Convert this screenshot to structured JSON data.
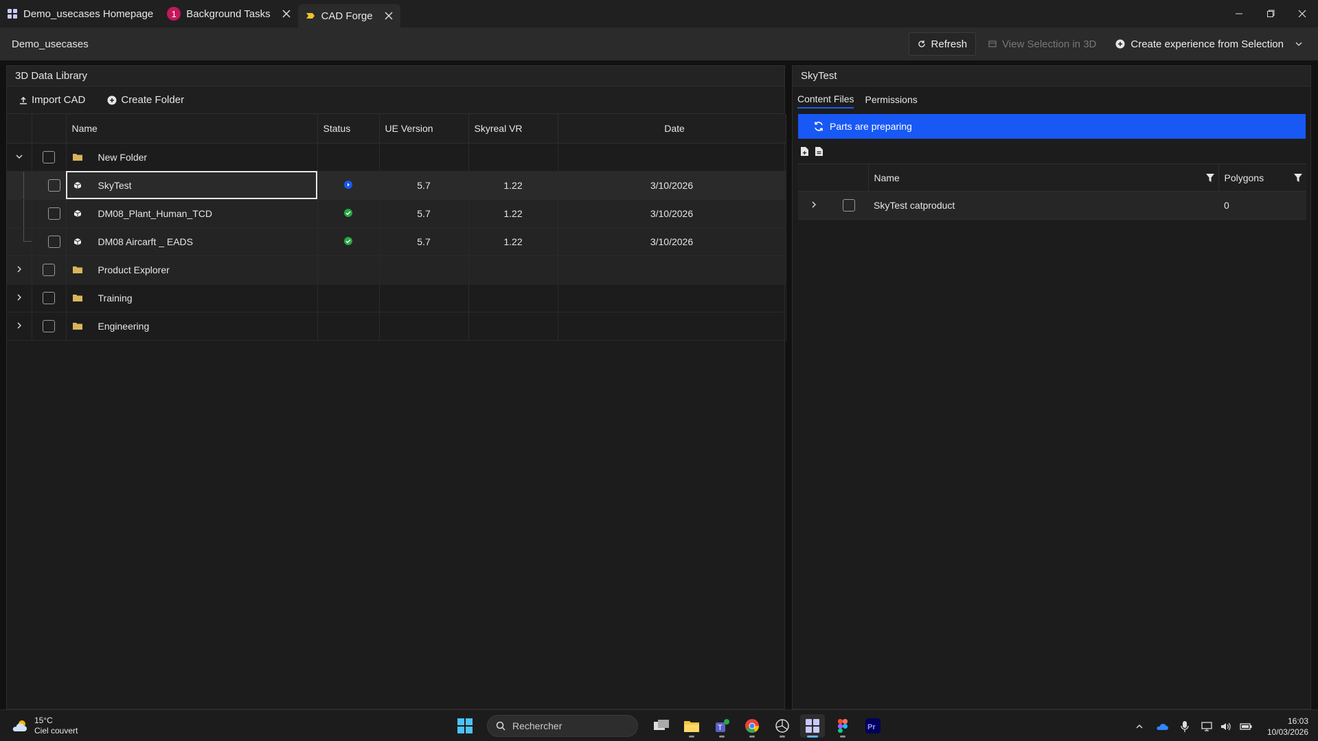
{
  "window": {
    "tabs": [
      {
        "label": "Demo_usecases Homepage"
      },
      {
        "label": "Background Tasks",
        "badge": "1"
      },
      {
        "label": "CAD Forge"
      }
    ]
  },
  "header": {
    "breadcrumb": "Demo_usecases",
    "refresh_label": "Refresh",
    "view_selection_label": "View Selection in 3D",
    "create_experience_label": "Create experience from Selection"
  },
  "library": {
    "title": "3D Data Library",
    "import_label": "Import CAD",
    "create_folder_label": "Create Folder",
    "columns": {
      "name": "Name",
      "status": "Status",
      "ue": "UE Version",
      "skyreal": "Skyreal VR",
      "date": "Date"
    },
    "rows": [
      {
        "name": "New Folder",
        "type": "folder",
        "expanded": true
      },
      {
        "name": "SkyTest",
        "type": "model",
        "status": "processing",
        "ue": "5.7",
        "skyreal": "1.22",
        "date": "3/10/2026"
      },
      {
        "name": "DM08_Plant_Human_TCD",
        "type": "model",
        "status": "ready",
        "ue": "5.7",
        "skyreal": "1.22",
        "date": "3/10/2026"
      },
      {
        "name": "DM08 Aircarft _ EADS",
        "type": "model",
        "status": "ready",
        "ue": "5.7",
        "skyreal": "1.22",
        "date": "3/10/2026"
      },
      {
        "name": "Product Explorer",
        "type": "folder"
      },
      {
        "name": "Training",
        "type": "folder"
      },
      {
        "name": "Engineering",
        "type": "folder"
      }
    ]
  },
  "details": {
    "title": "SkyTest",
    "tabs": [
      "Content Files",
      "Permissions"
    ],
    "banner": "Parts are preparing",
    "columns": {
      "name": "Name",
      "polygons": "Polygons"
    },
    "rows": [
      {
        "name": "SkyTest catproduct",
        "polygons": "0"
      }
    ]
  },
  "taskbar": {
    "temperature": "15°C",
    "weather": "Ciel couvert",
    "search_placeholder": "Rechercher",
    "time": "16:03",
    "date": "10/03/2026"
  },
  "colors": {
    "accent": "#1858f5",
    "ok": "#27a745",
    "folder": "#d9b45a"
  }
}
